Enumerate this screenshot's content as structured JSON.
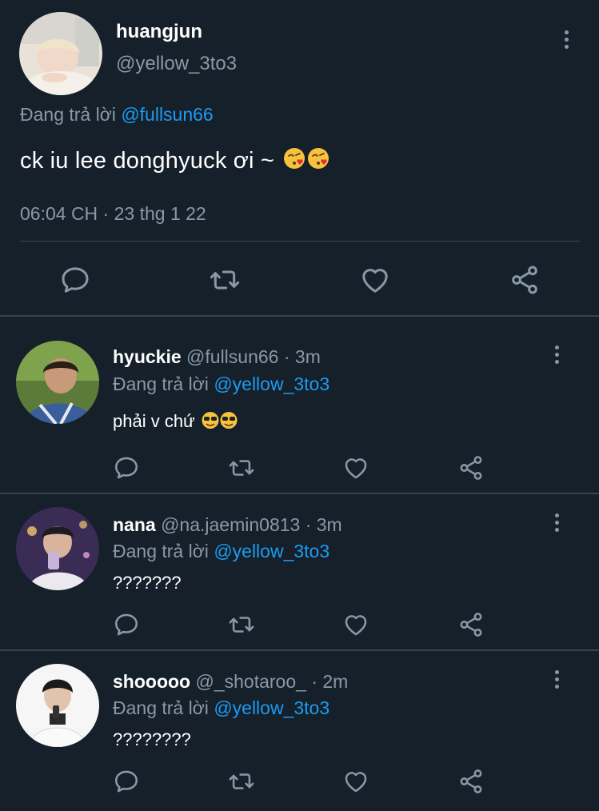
{
  "main_tweet": {
    "name": "huangjun",
    "handle": "@yellow_3to3",
    "replying_prefix": "Đang trả lời",
    "replying_to": "@fullsun66",
    "text": "ck iu lee donghyuck ơi ~",
    "emoji": "😘😘",
    "timestamp": "06:04 CH · 23 thg 1 22"
  },
  "replies": [
    {
      "name": "hyuckie",
      "handle": "@fullsun66",
      "time": "· 3m",
      "replying_prefix": "Đang trả lời",
      "replying_to": "@yellow_3to3",
      "text": "phải v chứ",
      "emoji": "😎😎"
    },
    {
      "name": "nana",
      "handle": "@na.jaemin0813",
      "time": "· 3m",
      "replying_prefix": "Đang trả lời",
      "replying_to": "@yellow_3to3",
      "text": "???????"
    },
    {
      "name": "shooooo",
      "handle": "@_shotaroo_",
      "time": "· 2m",
      "replying_prefix": "Đang trả lời",
      "replying_to": "@yellow_3to3",
      "text": "????????"
    }
  ],
  "icons": {
    "reply": "reply-icon",
    "retweet": "retweet-icon",
    "like": "heart-icon",
    "share": "share-icon",
    "more": "kebab-menu-icon"
  },
  "colors": {
    "background": "#15202b",
    "link": "#1d9bf0",
    "muted": "#8899a6",
    "divider": "#38444d"
  }
}
